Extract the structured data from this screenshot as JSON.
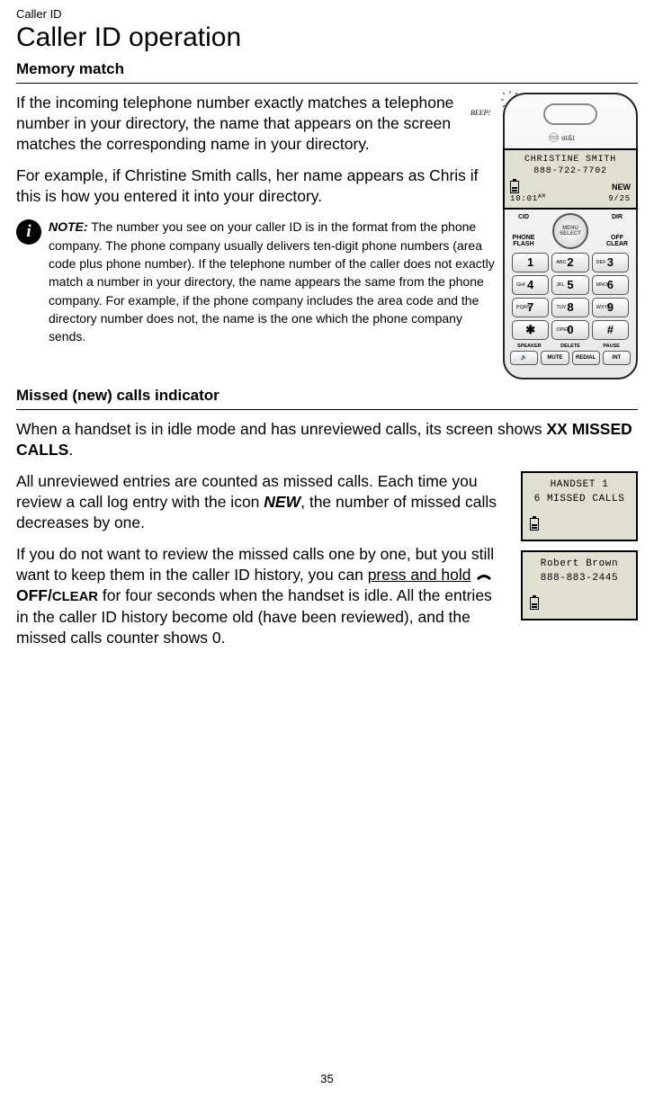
{
  "header": {
    "label": "Caller ID",
    "title": "Caller ID operation"
  },
  "section1": {
    "heading": "Memory match",
    "para1": "If the incoming telephone number exactly matches a telephone number in your directory, the name that appears on the screen matches the corresponding name in your directory.",
    "para2": "For example, if Christine Smith calls, her name appears as Chris if this is how you entered it into your directory.",
    "note_label": "NOTE:",
    "note_text": " The number you see on your caller ID is in the format from the phone company. The phone company usually delivers ten-digit phone numbers (area code plus phone number). If the telephone number of the caller does not exactly match a number in your directory, the name appears the same from the phone company. For example, if the phone company includes the area code and the directory number does not, the name is the one which the phone company sends."
  },
  "handset": {
    "beep": "BEEP!",
    "brand": "at&t",
    "lcd": {
      "name": "CHRISTINE SMITH",
      "number": "888-722-7702",
      "new_label": "NEW",
      "time": "10:01",
      "ampm": "AM",
      "date": "9/25"
    },
    "nav": {
      "cid": "CID",
      "dir": "DIR",
      "phone_flash": "PHONE\nFLASH",
      "off_clear": "OFF\nCLEAR",
      "menu": "MENU",
      "select": "SELECT"
    },
    "keys": [
      {
        "main": "1",
        "sub": ""
      },
      {
        "main": "2",
        "sub": "ABC"
      },
      {
        "main": "3",
        "sub": "DEF"
      },
      {
        "main": "4",
        "sub": "GHI"
      },
      {
        "main": "5",
        "sub": "JKL"
      },
      {
        "main": "6",
        "sub": "MNO"
      },
      {
        "main": "7",
        "sub": "PQRS"
      },
      {
        "main": "8",
        "sub": "TUV"
      },
      {
        "main": "9",
        "sub": "WXYZ"
      },
      {
        "main": "✱",
        "sub": ""
      },
      {
        "main": "0",
        "sub": "OPER"
      },
      {
        "main": "#",
        "sub": ""
      }
    ],
    "bottom_labels": [
      "SPEAKER",
      "DELETE",
      "PAUSE"
    ],
    "soft_keys": [
      "🔊",
      "MUTE",
      "REDIAL",
      "INT"
    ]
  },
  "section2": {
    "heading": "Missed (new) calls indicator",
    "para1_pre": "When a handset is in idle mode and has unreviewed calls, its screen shows ",
    "para1_bold": "XX MISSED CALLS",
    "para1_post": ".",
    "para2_pre": "All unreviewed entries are counted as missed calls. Each time you review a call log entry with the icon ",
    "para2_bold": "NEW",
    "para2_post": ", the number of missed calls decreases by one.",
    "para3_pre": "If you do not want to review the missed calls one by one, but you still want to keep them in the caller ID history, you can ",
    "para3_underline": "press and hold",
    "para3_mid1": " ",
    "para3_key": "OFF/",
    "para3_key2": "CLEAR",
    "para3_post": " for four seconds when the handset is idle. All the entries in the caller ID history become old (have been reviewed), and the missed calls counter shows 0.",
    "lcd1": {
      "line1": "HANDSET 1",
      "line2": "6 MISSED CALLS"
    },
    "lcd2": {
      "line1": "Robert Brown",
      "line2": "888-883-2445"
    }
  },
  "page_number": "35"
}
